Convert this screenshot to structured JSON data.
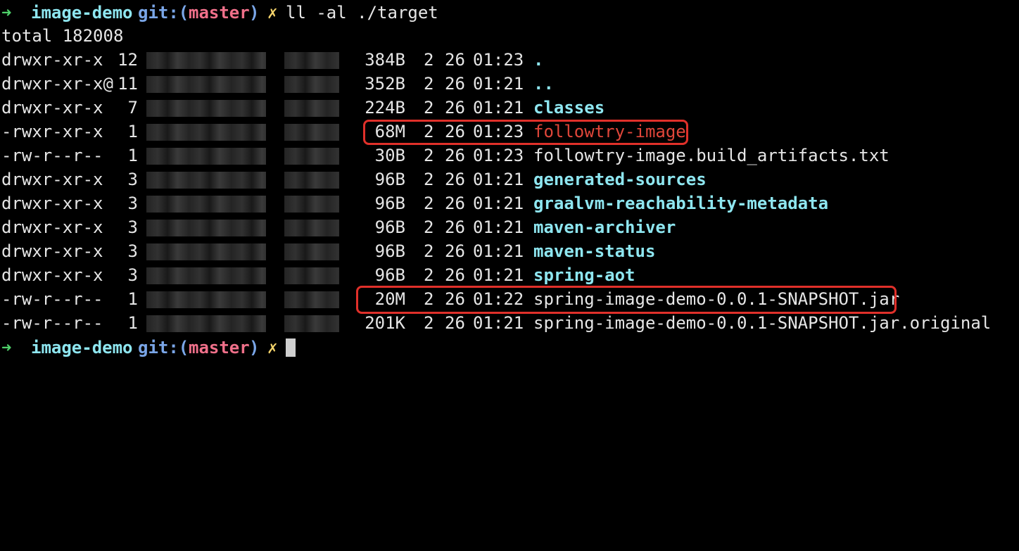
{
  "prompt": {
    "arrow": "➜",
    "dir": "image-demo",
    "git_prefix": "git:(",
    "branch": "master",
    "git_suffix": ")",
    "dirty": "✗"
  },
  "command": "ll -al ./target",
  "total": "total 182008",
  "rows": [
    {
      "perms": "drwxr-xr-x",
      "links": "12",
      "size": "384B",
      "month": "2",
      "day": "26",
      "time": "01:23",
      "name": "."
    },
    {
      "perms": "drwxr-xr-x@",
      "links": "11",
      "size": "352B",
      "month": "2",
      "day": "26",
      "time": "01:21",
      "name": ".."
    },
    {
      "perms": "drwxr-xr-x",
      "links": "7",
      "size": "224B",
      "month": "2",
      "day": "26",
      "time": "01:21",
      "name": "classes"
    },
    {
      "perms": "-rwxr-xr-x",
      "links": "1",
      "size": "68M",
      "month": "2",
      "day": "26",
      "time": "01:23",
      "name": "followtry-image"
    },
    {
      "perms": "-rw-r--r--",
      "links": "1",
      "size": "30B",
      "month": "2",
      "day": "26",
      "time": "01:23",
      "name": "followtry-image.build_artifacts.txt"
    },
    {
      "perms": "drwxr-xr-x",
      "links": "3",
      "size": "96B",
      "month": "2",
      "day": "26",
      "time": "01:21",
      "name": "generated-sources"
    },
    {
      "perms": "drwxr-xr-x",
      "links": "3",
      "size": "96B",
      "month": "2",
      "day": "26",
      "time": "01:21",
      "name": "graalvm-reachability-metadata"
    },
    {
      "perms": "drwxr-xr-x",
      "links": "3",
      "size": "96B",
      "month": "2",
      "day": "26",
      "time": "01:21",
      "name": "maven-archiver"
    },
    {
      "perms": "drwxr-xr-x",
      "links": "3",
      "size": "96B",
      "month": "2",
      "day": "26",
      "time": "01:21",
      "name": "maven-status"
    },
    {
      "perms": "drwxr-xr-x",
      "links": "3",
      "size": "96B",
      "month": "2",
      "day": "26",
      "time": "01:21",
      "name": "spring-aot"
    },
    {
      "perms": "-rw-r--r--",
      "links": "1",
      "size": "20M",
      "month": "2",
      "day": "26",
      "time": "01:22",
      "name": "spring-image-demo-0.0.1-SNAPSHOT.jar"
    },
    {
      "perms": "-rw-r--r--",
      "links": "1",
      "size": "201K",
      "month": "2",
      "day": "26",
      "time": "01:21",
      "name": "spring-image-demo-0.0.1-SNAPSHOT.jar.original"
    }
  ],
  "colors": {
    "background": "#000000",
    "directory": "#8ee6f0",
    "executable": "#e0463a",
    "highlight_box": "#e0302a",
    "prompt_arrow": "#4fd16a",
    "branch": "#f0708a",
    "dirty_marker": "#f5d46b"
  }
}
